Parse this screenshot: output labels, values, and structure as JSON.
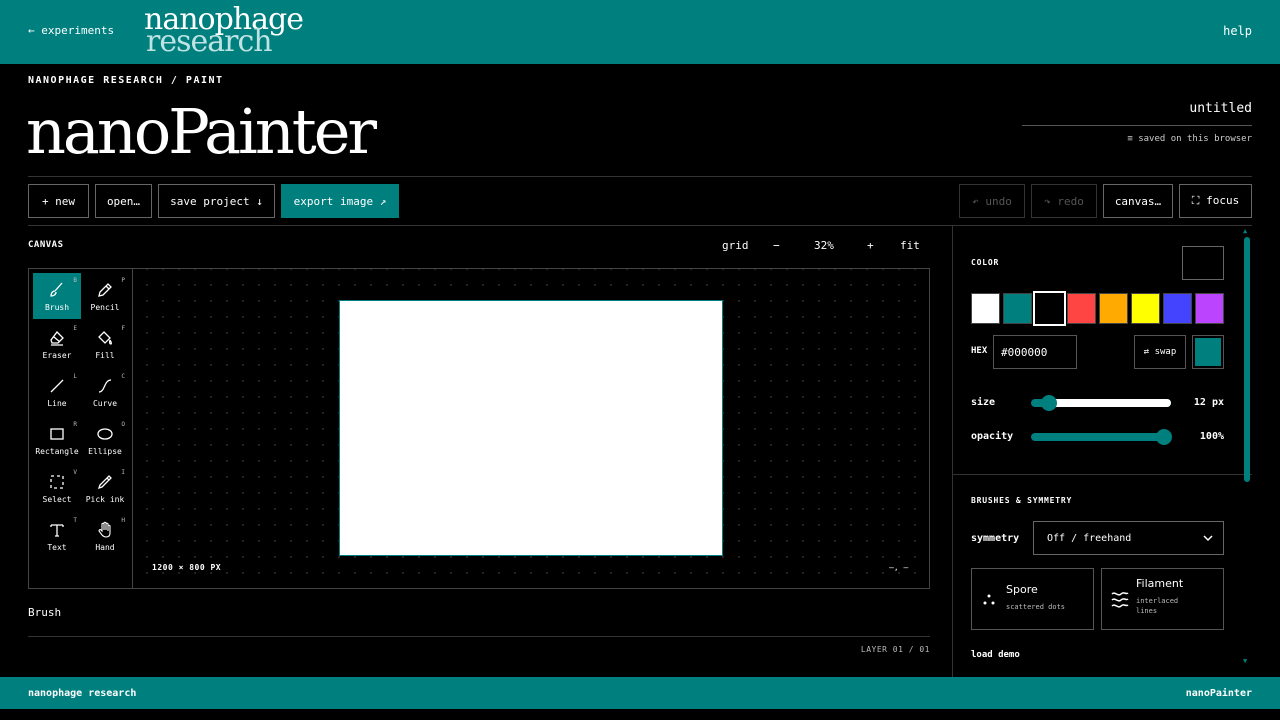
{
  "header": {
    "back_link": "← experiments",
    "logo_line1": "nanophage",
    "logo_line2": "research",
    "help": "help"
  },
  "breadcrumb": "NANOPHAGE RESEARCH / PAINT",
  "app_title": "nanoPainter",
  "document": {
    "name": "untitled",
    "status": "≡ saved on this browser"
  },
  "toolbar": {
    "new": "+ new",
    "open": "open…",
    "save": "save project ↓",
    "export": "export image ↗",
    "undo": "↶ undo",
    "redo": "↷ redo",
    "canvas": "canvas…",
    "focus": "⛶ focus"
  },
  "canvas_header": {
    "label": "CANVAS",
    "grid": "grid",
    "zoom_out": "−",
    "zoom": "32%",
    "zoom_in": "+",
    "fit": "fit"
  },
  "tools": [
    {
      "label": "Brush",
      "key": "B",
      "icon": "brush-icon",
      "active": true
    },
    {
      "label": "Pencil",
      "key": "P",
      "icon": "pencil-icon"
    },
    {
      "label": "Eraser",
      "key": "E",
      "icon": "eraser-icon"
    },
    {
      "label": "Fill",
      "key": "F",
      "icon": "fill-bucket-icon"
    },
    {
      "label": "Line",
      "key": "L",
      "icon": "line-icon"
    },
    {
      "label": "Curve",
      "key": "C",
      "icon": "curve-icon"
    },
    {
      "label": "Rectangle",
      "key": "R",
      "icon": "rectangle-icon"
    },
    {
      "label": "Ellipse",
      "key": "O",
      "icon": "ellipse-icon"
    },
    {
      "label": "Select",
      "key": "V",
      "icon": "select-icon"
    },
    {
      "label": "Pick ink",
      "key": "I",
      "icon": "eyedropper-icon"
    },
    {
      "label": "Text",
      "key": "T",
      "icon": "text-icon"
    },
    {
      "label": "Hand",
      "key": "H",
      "icon": "hand-icon"
    }
  ],
  "stage": {
    "dimensions": "1200 × 800 PX",
    "cursor": "—, —"
  },
  "status": {
    "tool": "Brush",
    "layer": "LAYER 01 / 01"
  },
  "color": {
    "label": "COLOR",
    "current": "#000000",
    "swatches": [
      "#ffffff",
      "#007f7f",
      "#000000",
      "#ff4444",
      "#ffaa00",
      "#ffff00",
      "#4444ff",
      "#bb44ff"
    ],
    "selected_index": 2,
    "hex_label": "HEX",
    "hex_value": "#000000",
    "swap": "⇄ swap",
    "secondary": "#007f7f"
  },
  "size": {
    "label": "size",
    "value": "12 px",
    "fraction": 0.13
  },
  "opacity": {
    "label": "opacity",
    "value": "100%",
    "fraction": 0.95
  },
  "brushes": {
    "label": "BRUSHES & SYMMETRY",
    "symmetry_label": "symmetry",
    "symmetry_value": "Off / freehand",
    "items": [
      {
        "name": "Spore",
        "desc": "scattered dots",
        "icon": "dots-icon"
      },
      {
        "name": "Filament",
        "desc": "interlaced lines",
        "icon": "waves-icon"
      }
    ],
    "load_demo": "load demo"
  },
  "footer": {
    "left": "nanophage research",
    "right": "nanoPainter"
  },
  "colors": {
    "accent": "#007f7f",
    "background": "#000000"
  }
}
